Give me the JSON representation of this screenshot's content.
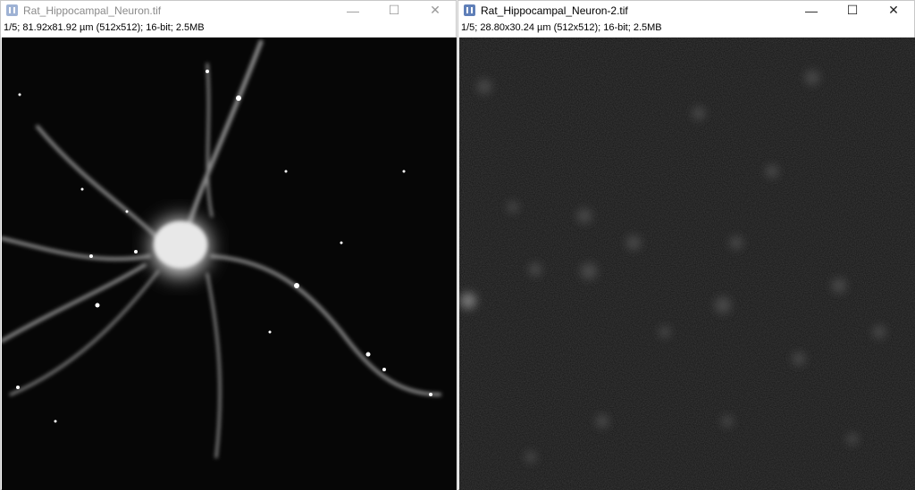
{
  "windows": [
    {
      "title": "Rat_Hippocampal_Neuron.tif",
      "info": "1/5; 81.92x81.92 µm (512x512); 16-bit; 2.5MB",
      "active": false
    },
    {
      "title": "Rat_Hippocampal_Neuron-2.tif",
      "info": "1/5; 28.80x30.24 µm (512x512); 16-bit; 2.5MB",
      "active": true
    }
  ],
  "controls": {
    "minimize": "—",
    "maximize": "☐",
    "close": "✕"
  }
}
